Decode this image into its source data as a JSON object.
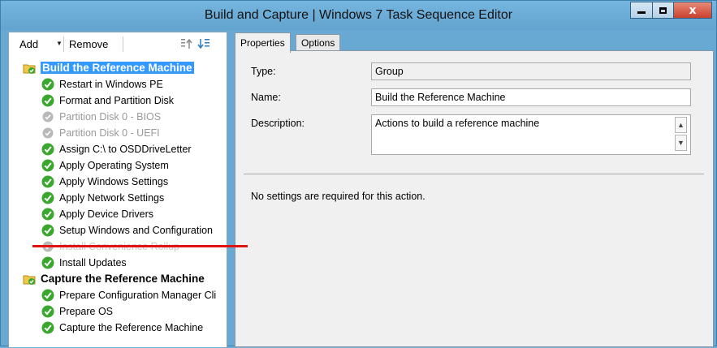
{
  "window": {
    "title": "Build and Capture | Windows 7 Task Sequence Editor",
    "min_label": "–",
    "close_label": "x"
  },
  "toolbar": {
    "add_label": "Add",
    "add_caret": "▼",
    "remove_label": "Remove"
  },
  "tree": {
    "items": [
      {
        "label": "Build the Reference Machine",
        "type": "group",
        "state": "selected"
      },
      {
        "label": "Restart in Windows PE",
        "type": "step",
        "state": "enabled"
      },
      {
        "label": "Format and Partition Disk",
        "type": "step",
        "state": "enabled"
      },
      {
        "label": "Partition Disk 0 - BIOS",
        "type": "step",
        "state": "disabled"
      },
      {
        "label": "Partition Disk 0 - UEFI",
        "type": "step",
        "state": "disabled"
      },
      {
        "label": "Assign C:\\ to OSDDriveLetter",
        "type": "step",
        "state": "enabled"
      },
      {
        "label": "Apply Operating System",
        "type": "step",
        "state": "enabled"
      },
      {
        "label": "Apply Windows Settings",
        "type": "step",
        "state": "enabled"
      },
      {
        "label": "Apply Network Settings",
        "type": "step",
        "state": "enabled"
      },
      {
        "label": "Apply Device Drivers",
        "type": "step",
        "state": "enabled"
      },
      {
        "label": "Setup Windows and Configuration",
        "type": "step",
        "state": "enabled"
      },
      {
        "label": "Install Convenience Rollup",
        "type": "step",
        "state": "disabled"
      },
      {
        "label": "Install Updates",
        "type": "step",
        "state": "enabled"
      },
      {
        "label": "Capture the Reference Machine",
        "type": "group",
        "state": "normal"
      },
      {
        "label": "Prepare Configuration Manager Cli",
        "type": "step",
        "state": "enabled"
      },
      {
        "label": "Prepare OS",
        "type": "step",
        "state": "enabled"
      },
      {
        "label": "Capture the Reference Machine",
        "type": "step",
        "state": "enabled"
      }
    ]
  },
  "tabs": {
    "properties": "Properties",
    "options": "Options"
  },
  "properties": {
    "type_label": "Type:",
    "type_value": "Group",
    "name_label": "Name:",
    "name_value": "Build the Reference Machine",
    "description_label": "Description:",
    "description_value": "Actions to build a reference machine",
    "note": "No settings are required  for this action."
  },
  "colors": {
    "title_bar": "#68a9d3",
    "selection": "#3399ff",
    "success_green": "#3aa82f",
    "annotation_red": "#e01313"
  }
}
